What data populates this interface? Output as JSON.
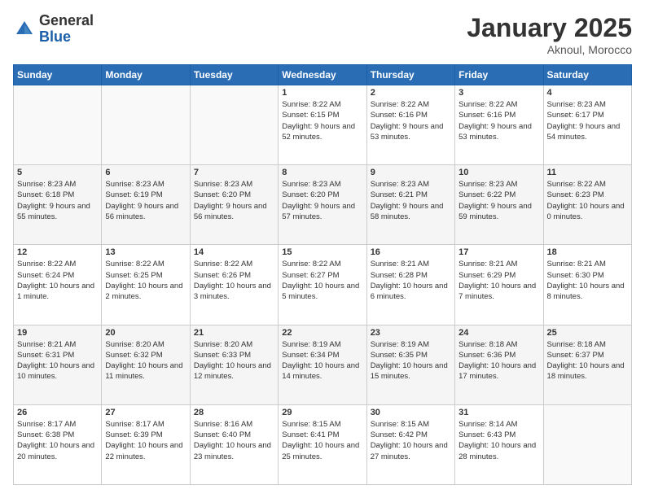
{
  "logo": {
    "general": "General",
    "blue": "Blue"
  },
  "title": "January 2025",
  "location": "Aknoul, Morocco",
  "days_of_week": [
    "Sunday",
    "Monday",
    "Tuesday",
    "Wednesday",
    "Thursday",
    "Friday",
    "Saturday"
  ],
  "weeks": [
    [
      {
        "day": "",
        "info": ""
      },
      {
        "day": "",
        "info": ""
      },
      {
        "day": "",
        "info": ""
      },
      {
        "day": "1",
        "sunrise": "Sunrise: 8:22 AM",
        "sunset": "Sunset: 6:15 PM",
        "daylight": "Daylight: 9 hours and 52 minutes."
      },
      {
        "day": "2",
        "sunrise": "Sunrise: 8:22 AM",
        "sunset": "Sunset: 6:16 PM",
        "daylight": "Daylight: 9 hours and 53 minutes."
      },
      {
        "day": "3",
        "sunrise": "Sunrise: 8:22 AM",
        "sunset": "Sunset: 6:16 PM",
        "daylight": "Daylight: 9 hours and 53 minutes."
      },
      {
        "day": "4",
        "sunrise": "Sunrise: 8:23 AM",
        "sunset": "Sunset: 6:17 PM",
        "daylight": "Daylight: 9 hours and 54 minutes."
      }
    ],
    [
      {
        "day": "5",
        "sunrise": "Sunrise: 8:23 AM",
        "sunset": "Sunset: 6:18 PM",
        "daylight": "Daylight: 9 hours and 55 minutes."
      },
      {
        "day": "6",
        "sunrise": "Sunrise: 8:23 AM",
        "sunset": "Sunset: 6:19 PM",
        "daylight": "Daylight: 9 hours and 56 minutes."
      },
      {
        "day": "7",
        "sunrise": "Sunrise: 8:23 AM",
        "sunset": "Sunset: 6:20 PM",
        "daylight": "Daylight: 9 hours and 56 minutes."
      },
      {
        "day": "8",
        "sunrise": "Sunrise: 8:23 AM",
        "sunset": "Sunset: 6:20 PM",
        "daylight": "Daylight: 9 hours and 57 minutes."
      },
      {
        "day": "9",
        "sunrise": "Sunrise: 8:23 AM",
        "sunset": "Sunset: 6:21 PM",
        "daylight": "Daylight: 9 hours and 58 minutes."
      },
      {
        "day": "10",
        "sunrise": "Sunrise: 8:23 AM",
        "sunset": "Sunset: 6:22 PM",
        "daylight": "Daylight: 9 hours and 59 minutes."
      },
      {
        "day": "11",
        "sunrise": "Sunrise: 8:22 AM",
        "sunset": "Sunset: 6:23 PM",
        "daylight": "Daylight: 10 hours and 0 minutes."
      }
    ],
    [
      {
        "day": "12",
        "sunrise": "Sunrise: 8:22 AM",
        "sunset": "Sunset: 6:24 PM",
        "daylight": "Daylight: 10 hours and 1 minute."
      },
      {
        "day": "13",
        "sunrise": "Sunrise: 8:22 AM",
        "sunset": "Sunset: 6:25 PM",
        "daylight": "Daylight: 10 hours and 2 minutes."
      },
      {
        "day": "14",
        "sunrise": "Sunrise: 8:22 AM",
        "sunset": "Sunset: 6:26 PM",
        "daylight": "Daylight: 10 hours and 3 minutes."
      },
      {
        "day": "15",
        "sunrise": "Sunrise: 8:22 AM",
        "sunset": "Sunset: 6:27 PM",
        "daylight": "Daylight: 10 hours and 5 minutes."
      },
      {
        "day": "16",
        "sunrise": "Sunrise: 8:21 AM",
        "sunset": "Sunset: 6:28 PM",
        "daylight": "Daylight: 10 hours and 6 minutes."
      },
      {
        "day": "17",
        "sunrise": "Sunrise: 8:21 AM",
        "sunset": "Sunset: 6:29 PM",
        "daylight": "Daylight: 10 hours and 7 minutes."
      },
      {
        "day": "18",
        "sunrise": "Sunrise: 8:21 AM",
        "sunset": "Sunset: 6:30 PM",
        "daylight": "Daylight: 10 hours and 8 minutes."
      }
    ],
    [
      {
        "day": "19",
        "sunrise": "Sunrise: 8:21 AM",
        "sunset": "Sunset: 6:31 PM",
        "daylight": "Daylight: 10 hours and 10 minutes."
      },
      {
        "day": "20",
        "sunrise": "Sunrise: 8:20 AM",
        "sunset": "Sunset: 6:32 PM",
        "daylight": "Daylight: 10 hours and 11 minutes."
      },
      {
        "day": "21",
        "sunrise": "Sunrise: 8:20 AM",
        "sunset": "Sunset: 6:33 PM",
        "daylight": "Daylight: 10 hours and 12 minutes."
      },
      {
        "day": "22",
        "sunrise": "Sunrise: 8:19 AM",
        "sunset": "Sunset: 6:34 PM",
        "daylight": "Daylight: 10 hours and 14 minutes."
      },
      {
        "day": "23",
        "sunrise": "Sunrise: 8:19 AM",
        "sunset": "Sunset: 6:35 PM",
        "daylight": "Daylight: 10 hours and 15 minutes."
      },
      {
        "day": "24",
        "sunrise": "Sunrise: 8:18 AM",
        "sunset": "Sunset: 6:36 PM",
        "daylight": "Daylight: 10 hours and 17 minutes."
      },
      {
        "day": "25",
        "sunrise": "Sunrise: 8:18 AM",
        "sunset": "Sunset: 6:37 PM",
        "daylight": "Daylight: 10 hours and 18 minutes."
      }
    ],
    [
      {
        "day": "26",
        "sunrise": "Sunrise: 8:17 AM",
        "sunset": "Sunset: 6:38 PM",
        "daylight": "Daylight: 10 hours and 20 minutes."
      },
      {
        "day": "27",
        "sunrise": "Sunrise: 8:17 AM",
        "sunset": "Sunset: 6:39 PM",
        "daylight": "Daylight: 10 hours and 22 minutes."
      },
      {
        "day": "28",
        "sunrise": "Sunrise: 8:16 AM",
        "sunset": "Sunset: 6:40 PM",
        "daylight": "Daylight: 10 hours and 23 minutes."
      },
      {
        "day": "29",
        "sunrise": "Sunrise: 8:15 AM",
        "sunset": "Sunset: 6:41 PM",
        "daylight": "Daylight: 10 hours and 25 minutes."
      },
      {
        "day": "30",
        "sunrise": "Sunrise: 8:15 AM",
        "sunset": "Sunset: 6:42 PM",
        "daylight": "Daylight: 10 hours and 27 minutes."
      },
      {
        "day": "31",
        "sunrise": "Sunrise: 8:14 AM",
        "sunset": "Sunset: 6:43 PM",
        "daylight": "Daylight: 10 hours and 28 minutes."
      },
      {
        "day": "",
        "info": ""
      }
    ]
  ]
}
